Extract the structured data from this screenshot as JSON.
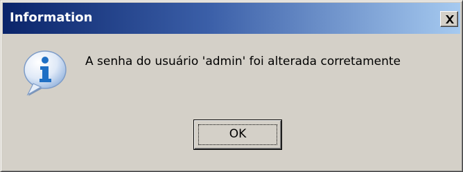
{
  "window": {
    "title": "Information",
    "close_glyph": "X"
  },
  "dialog": {
    "icon": "info-icon",
    "message": "A senha do usuário 'admin' foi alterada corretamente",
    "ok_label": "OK"
  },
  "colors": {
    "title_gradient_start": "#0a246a",
    "title_gradient_end": "#a6caf0",
    "face": "#d4d0c8",
    "icon_blue": "#1f6fc4"
  }
}
